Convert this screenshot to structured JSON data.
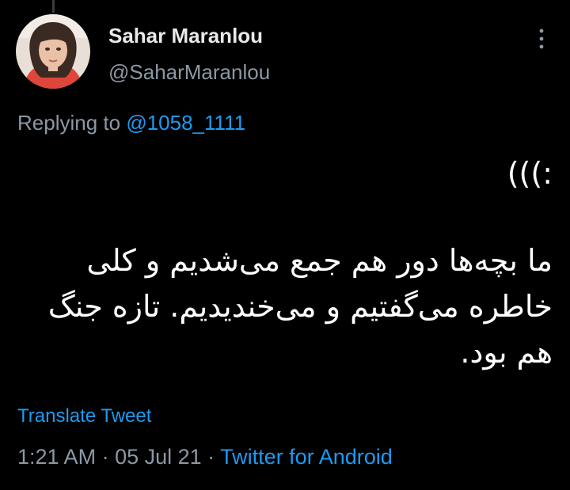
{
  "author": {
    "display_name": "Sahar Maranlou",
    "handle": "@SaharMaranlou",
    "avatar_icon": "profile-photo"
  },
  "menu_icon": "more-vertical-icon",
  "reply": {
    "prefix": "Replying to ",
    "mention": "@1058_1111"
  },
  "tweet": {
    "paragraphs": [
      ":)))",
      "ما بچه‌ها دور هم جمع می‌شدیم و کلی خاطره می‌گفتیم و می‌خندیدیم. تازه جنگ هم بود."
    ]
  },
  "translate_label": "Translate Tweet",
  "meta": {
    "time": "1:21 AM",
    "separator1": " · ",
    "date": "05 Jul 21",
    "separator2": " · ",
    "source": "Twitter for Android"
  },
  "colors": {
    "background": "#000000",
    "text": "#e7e9ea",
    "secondary": "#8b98a5",
    "link": "#1d9bf0"
  }
}
